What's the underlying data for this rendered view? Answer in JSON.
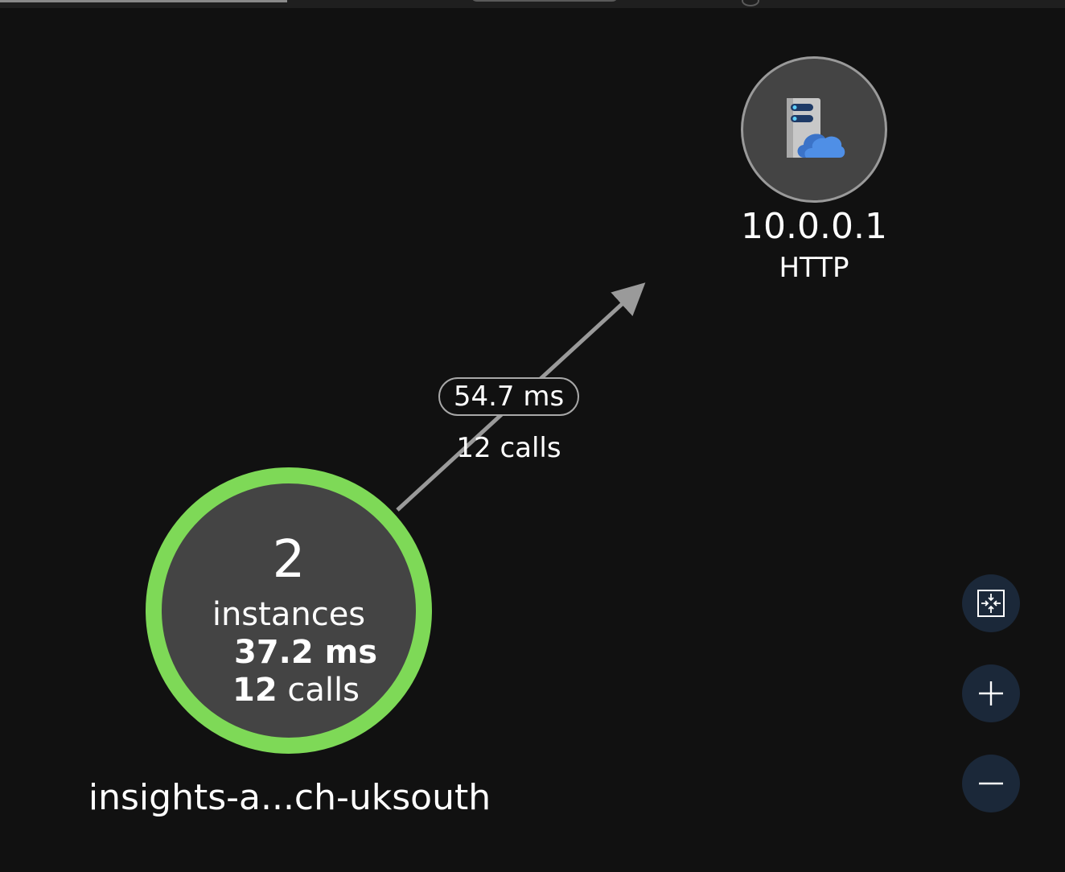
{
  "colors": {
    "background": "#111111",
    "node_fill": "#444444",
    "healthy_ring": "#7ed957",
    "dependency_ring": "#9a9a9a",
    "edge": "#9a9a9a",
    "control_button": "#1b2839"
  },
  "app_node": {
    "count": "2",
    "instances_label": "instances",
    "latency": "37.2 ms",
    "calls_count": "12",
    "calls_label": "calls",
    "name": "insights-a...ch-uksouth",
    "health": "healthy"
  },
  "dependency_node": {
    "icon": "server-cloud-icon",
    "name": "10.0.0.1",
    "type": "HTTP"
  },
  "edge": {
    "latency": "54.7 ms",
    "calls": "12 calls"
  },
  "controls": {
    "fit_icon": "fit-to-screen-icon",
    "zoom_in_icon": "plus-icon",
    "zoom_out_icon": "minus-icon"
  }
}
